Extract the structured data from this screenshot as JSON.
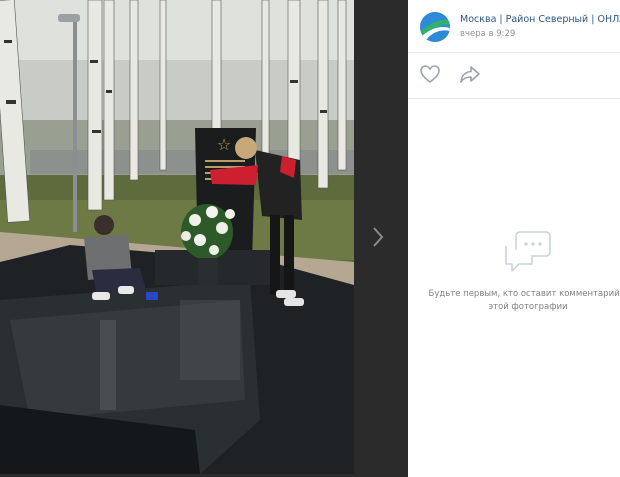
{
  "post": {
    "author": "Москва | Район Северный | ОНЛАЙН",
    "time": "вчера в 9:29"
  },
  "icons": {
    "like": "heart-icon",
    "share": "share-arrow-icon",
    "next": "chevron-right-icon",
    "empty": "comment-bubbles-icon"
  },
  "comments": {
    "empty_text": "Будьте первым, кто оставит комментарий к этой фотографии"
  },
  "colors": {
    "link": "#2a5885",
    "muted": "#939393",
    "avatar": "#3b8fd6"
  }
}
